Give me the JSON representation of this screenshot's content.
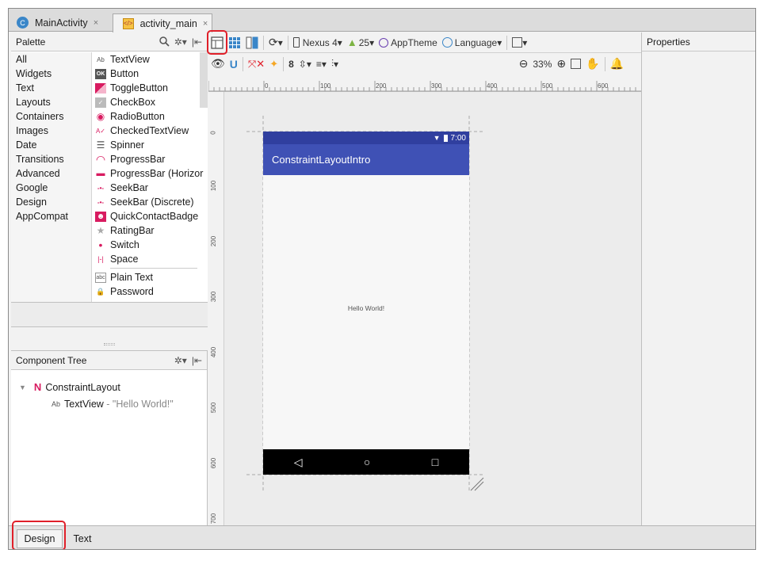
{
  "tabs": [
    {
      "label": "MainActivity",
      "icon": "class-icon",
      "close": "×"
    },
    {
      "label": "activity_main",
      "icon": "layout-xml-icon",
      "close": "×"
    }
  ],
  "palette": {
    "title": "Palette",
    "categories": [
      "All",
      "Widgets",
      "Text",
      "Layouts",
      "Containers",
      "Images",
      "Date",
      "Transitions",
      "Advanced",
      "Google",
      "Design",
      "AppCompat"
    ],
    "widgets": [
      {
        "label": "TextView",
        "icon": "Ab"
      },
      {
        "label": "Button",
        "icon": "OK"
      },
      {
        "label": "ToggleButton",
        "icon": ""
      },
      {
        "label": "CheckBox",
        "icon": "✓"
      },
      {
        "label": "RadioButton",
        "icon": "◉"
      },
      {
        "label": "CheckedTextView",
        "icon": "A✓"
      },
      {
        "label": "Spinner",
        "icon": "☰"
      },
      {
        "label": "ProgressBar",
        "icon": "◠"
      },
      {
        "label": "ProgressBar (Horizor",
        "icon": "▬"
      },
      {
        "label": "SeekBar",
        "icon": "-•-"
      },
      {
        "label": "SeekBar (Discrete)",
        "icon": "-•-"
      },
      {
        "label": "QuickContactBadge",
        "icon": "☻"
      },
      {
        "label": "RatingBar",
        "icon": "★"
      },
      {
        "label": "Switch",
        "icon": "•"
      },
      {
        "label": "Space",
        "icon": "|-|"
      },
      {
        "label": "Plain Text",
        "icon": "abc"
      },
      {
        "label": "Password",
        "icon": "🔒"
      }
    ]
  },
  "component_tree": {
    "title": "Component Tree",
    "root": "ConstraintLayout",
    "child_label": "TextView",
    "child_value": "- \"Hello World!\"",
    "child_icon": "Ab"
  },
  "toolbar": {
    "device": "Nexus 4",
    "api": "25",
    "theme": "AppTheme",
    "language": "Language",
    "margin": "8",
    "zoom": "33%"
  },
  "ruler": {
    "h": [
      "0",
      "100",
      "200",
      "300",
      "400",
      "500",
      "600"
    ],
    "v": [
      "0",
      "100",
      "200",
      "300",
      "400",
      "500",
      "600",
      "700"
    ]
  },
  "preview": {
    "time": "7:00",
    "app_title": "ConstraintLayoutIntro",
    "hello": "Hello World!",
    "nav_back": "◁",
    "nav_home": "○",
    "nav_recents": "□"
  },
  "properties": {
    "title": "Properties"
  },
  "bottom_tabs": [
    "Design",
    "Text"
  ],
  "colors": {
    "primary": "#3f51b5",
    "primary_dark": "#303f9f",
    "highlight": "#e0202a",
    "widget_pink": "#d81b60"
  }
}
